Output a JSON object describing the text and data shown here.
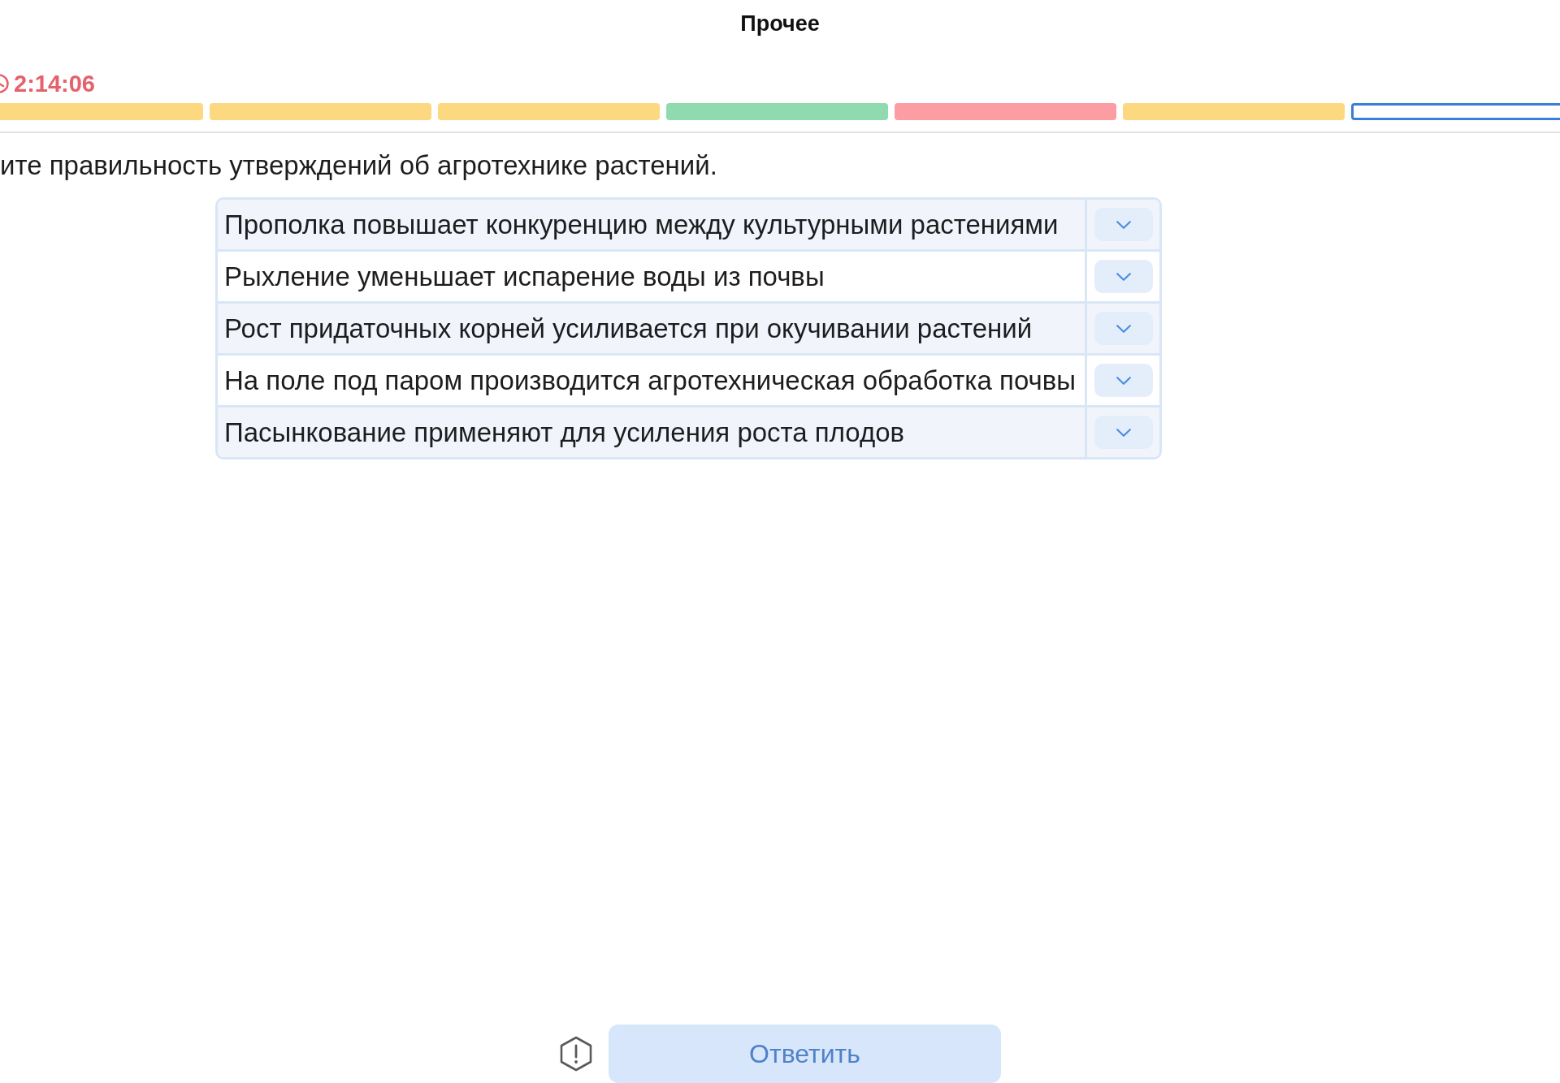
{
  "header": {
    "title": "Прочее"
  },
  "timer": {
    "time": "2:14:06"
  },
  "progress": {
    "segments": [
      {
        "color": "#fcd980",
        "selected": false
      },
      {
        "color": "#fcd980",
        "selected": false
      },
      {
        "color": "#fcd980",
        "selected": false
      },
      {
        "color": "#8fdaaf",
        "selected": false
      },
      {
        "color": "#fb9da3",
        "selected": false
      },
      {
        "color": "#fcd980",
        "selected": false
      },
      {
        "color": "#3a7fd5",
        "selected": true
      }
    ]
  },
  "question": {
    "text": "ите правильность утверждений об агротехнике растений."
  },
  "statements": [
    {
      "text": "Прополка повышает конкуренцию между культурными растениями"
    },
    {
      "text": "Рыхление уменьшает испарение воды из почвы"
    },
    {
      "text": "Рост придаточных корней усиливается при окучивании растений"
    },
    {
      "text": "На поле под паром производится агротехническая обработка почвы"
    },
    {
      "text": "Пасынкование применяют для усиления роста плодов"
    }
  ],
  "footer": {
    "answer_button": {
      "label": "Ответить",
      "disabled": true
    }
  }
}
